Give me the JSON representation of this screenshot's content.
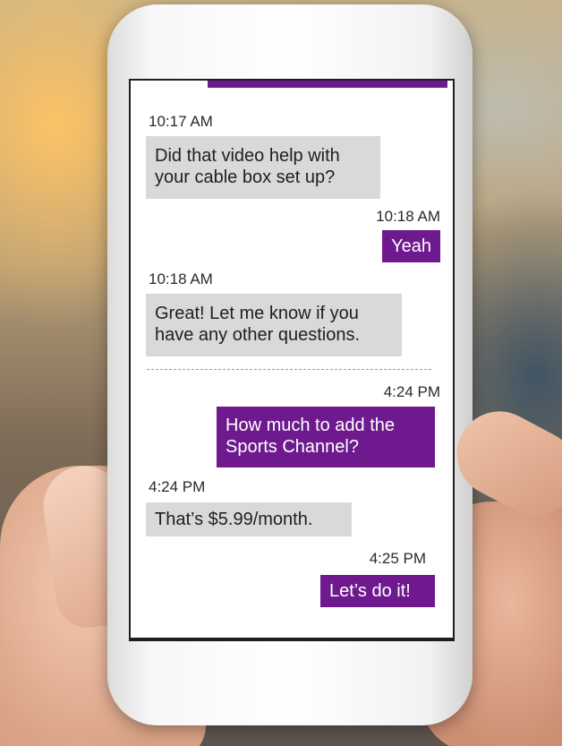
{
  "colors": {
    "outgoing_bubble": "#6e1a8e",
    "incoming_bubble": "#d8d9da",
    "accent_bar": "#6d1a8c"
  },
  "conversation": {
    "messages": [
      {
        "direction": "in",
        "time": "10:17 AM",
        "lines": [
          "Did that video help with",
          "your cable box set up?"
        ]
      },
      {
        "direction": "out",
        "time": "10:18 AM",
        "lines": [
          "Yeah"
        ]
      },
      {
        "direction": "in",
        "time": "10:18 AM",
        "lines": [
          "Great! Let me know if you",
          "have any other questions."
        ]
      },
      {
        "direction": "out",
        "time": "4:24 PM",
        "lines": [
          "How much to add the",
          "Sports Channel?"
        ]
      },
      {
        "direction": "in",
        "time": "4:24 PM",
        "lines": [
          "That’s $5.99/month."
        ]
      },
      {
        "direction": "out",
        "time": "4:25 PM",
        "lines": [
          "Let’s do it!"
        ]
      }
    ]
  }
}
